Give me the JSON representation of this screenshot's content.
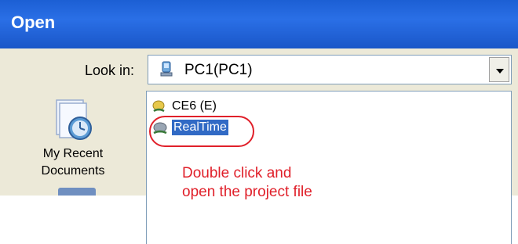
{
  "window": {
    "title": "Open"
  },
  "toolbar": {
    "look_in_label": "Look in:",
    "look_in_value": "PC1(PC1)",
    "look_in_icon": "computer-icon"
  },
  "places_bar": {
    "items": [
      {
        "label_line1": "My Recent",
        "label_line2": "Documents",
        "icon": "recent-documents-icon"
      }
    ]
  },
  "file_list": {
    "items": [
      {
        "label": "CE6 (E)",
        "icon": "drive-icon",
        "selected": false
      },
      {
        "label": "RealTime",
        "icon": "network-project-icon",
        "selected": true
      }
    ]
  },
  "annotation": {
    "line1": "Double click and",
    "line2": "open the project file",
    "color": "#e0202a"
  },
  "colors": {
    "titlebar": "#1c5fd4",
    "dialog_bg": "#ece9d8",
    "selection": "#316ac5"
  }
}
